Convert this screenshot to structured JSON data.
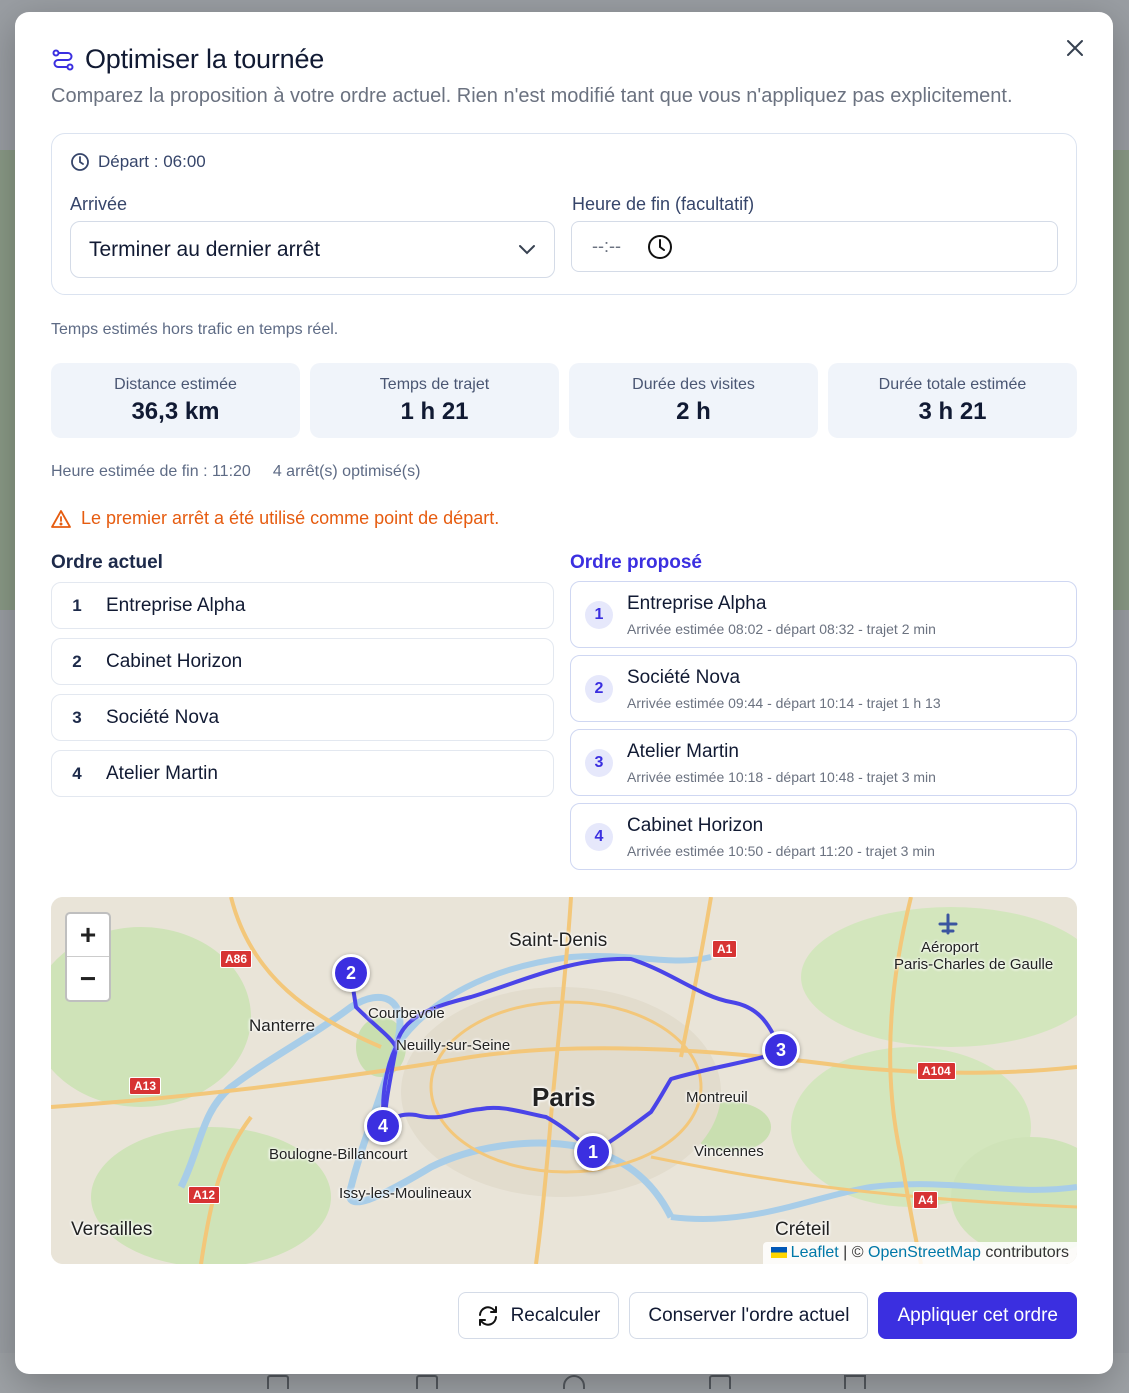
{
  "header": {
    "title": "Optimiser la tournée",
    "subtitle": "Comparez la proposition à votre ordre actuel. Rien n'est modifié tant que vous n'appliquez pas explicitement."
  },
  "settings": {
    "depart": "Départ : 06:00",
    "arrivee_label": "Arrivée",
    "arrivee_value": "Terminer au dernier arrêt",
    "fin_label": "Heure de fin (facultatif)",
    "fin_placeholder": "--:--"
  },
  "note": "Temps estimés hors trafic en temps réel.",
  "stats": [
    {
      "label": "Distance estimée",
      "value": "36,3 km"
    },
    {
      "label": "Temps de trajet",
      "value": "1 h 21"
    },
    {
      "label": "Durée des visites",
      "value": "2 h"
    },
    {
      "label": "Durée totale estimée",
      "value": "3 h 21"
    }
  ],
  "meta": {
    "fin": "Heure estimée de fin : 11:20",
    "optimises": "4 arrêt(s) optimisé(s)"
  },
  "warning": "Le premier arrêt a été utilisé comme point de départ.",
  "current": {
    "title": "Ordre actuel",
    "items": [
      {
        "num": "1",
        "name": "Entreprise Alpha"
      },
      {
        "num": "2",
        "name": "Cabinet Horizon"
      },
      {
        "num": "3",
        "name": "Société Nova"
      },
      {
        "num": "4",
        "name": "Atelier Martin"
      }
    ]
  },
  "proposed": {
    "title": "Ordre proposé",
    "items": [
      {
        "num": "1",
        "name": "Entreprise Alpha",
        "detail": "Arrivée estimée 08:02 - départ 08:32 - trajet 2 min"
      },
      {
        "num": "2",
        "name": "Société Nova",
        "detail": "Arrivée estimée 09:44 - départ 10:14 - trajet 1 h 13"
      },
      {
        "num": "3",
        "name": "Atelier Martin",
        "detail": "Arrivée estimée 10:18 - départ 10:48 - trajet 3 min"
      },
      {
        "num": "4",
        "name": "Cabinet Horizon",
        "detail": "Arrivée estimée 10:50 - départ 11:20 - trajet 3 min"
      }
    ]
  },
  "map": {
    "zoom_in": "+",
    "zoom_out": "−",
    "labels": {
      "saint_denis": "Saint-Denis",
      "aeroport": "Aéroport",
      "cdg": "Paris-Charles de Gaulle",
      "nanterre": "Nanterre",
      "courbevoie": "Courbevoie",
      "neuilly": "Neuilly-sur-Seine",
      "paris": "Paris",
      "montreuil": "Montreuil",
      "vincennes": "Vincennes",
      "boulogne": "Boulogne-Billancourt",
      "issy": "Issy-les-Moulineaux",
      "versailles": "Versailles",
      "creteil": "Créteil"
    },
    "roads": {
      "a86": "A86",
      "a1": "A1",
      "a13": "A13",
      "a104": "A104",
      "a12": "A12",
      "a4": "A4"
    },
    "markers": [
      "1",
      "2",
      "3",
      "4"
    ],
    "attribution": {
      "leaflet": "Leaflet",
      "sep": " | © ",
      "osm": "OpenStreetMap",
      "contrib": " contributors"
    },
    "route_color": "#4a44e8"
  },
  "buttons": {
    "recalculer": "Recalculer",
    "conserver": "Conserver l'ordre actuel",
    "appliquer": "Appliquer cet ordre"
  },
  "colors": {
    "accent": "#3b2fe0",
    "warning": "#e65c10"
  }
}
